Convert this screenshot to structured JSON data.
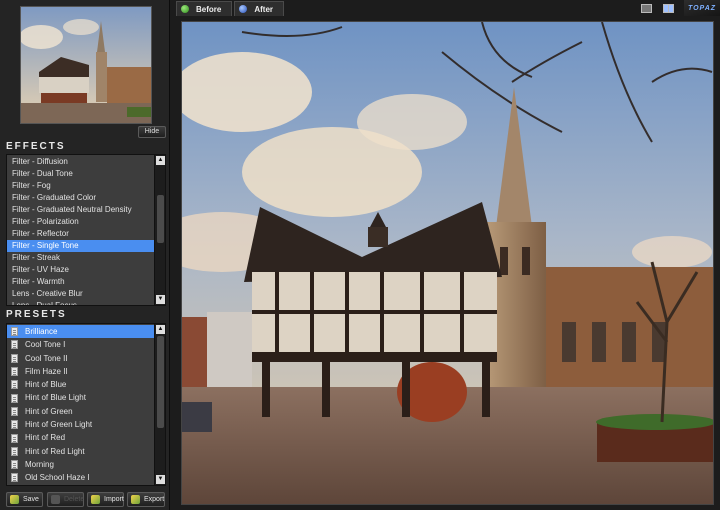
{
  "hide_label": "Hide",
  "effects": {
    "title": "EFFECTS",
    "items": [
      "Filter - Diffusion",
      "Filter - Dual Tone",
      "Filter - Fog",
      "Filter - Graduated Color",
      "Filter - Graduated Neutral Density",
      "Filter - Polarization",
      "Filter - Reflector",
      "Filter - Single Tone",
      "Filter - Streak",
      "Filter - UV Haze",
      "Filter - Warmth",
      "Lens - Creative Blur",
      "Lens - Dual Focus"
    ],
    "selected": "Filter - Single Tone"
  },
  "presets": {
    "title": "PRESETS",
    "items": [
      "Brilliance",
      "Cool Tone I",
      "Cool Tone II",
      "Film Haze II",
      "Hint of Blue",
      "Hint of Blue Light",
      "Hint of Green",
      "Hint of Green Light",
      "Hint of Red",
      "Hint of Red Light",
      "Morning",
      "Old School Haze I"
    ],
    "selected": "Brilliance"
  },
  "bottom_buttons": {
    "save": "Save",
    "delete": "Delete",
    "import": "Import",
    "export": "Export"
  },
  "tabs": {
    "before": "Before",
    "after": "After"
  },
  "brand": "TOPAZ",
  "colors": {
    "selection": "#4a8ef0",
    "panel": "#242424",
    "list_bg": "#3d3d3d"
  }
}
